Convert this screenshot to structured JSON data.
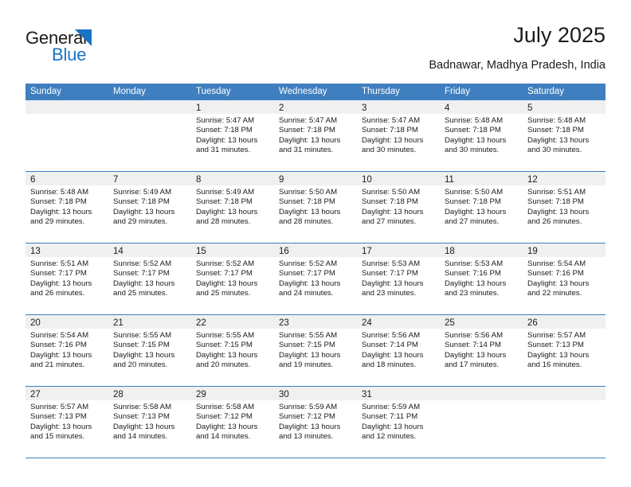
{
  "brand": {
    "name_part1": "General",
    "name_part2": "Blue",
    "accent_color": "#1b73c4"
  },
  "header": {
    "title": "July 2025",
    "location": "Badnawar, Madhya Pradesh, India"
  },
  "calendar": {
    "header_bg_color": "#3f7fbf",
    "day_band_color": "#f0f0f0",
    "weekday_headers": [
      "Sunday",
      "Monday",
      "Tuesday",
      "Wednesday",
      "Thursday",
      "Friday",
      "Saturday"
    ],
    "weeks": [
      [
        {
          "day": "",
          "lines": []
        },
        {
          "day": "",
          "lines": []
        },
        {
          "day": "1",
          "lines": [
            "Sunrise: 5:47 AM",
            "Sunset: 7:18 PM",
            "Daylight: 13 hours",
            "and 31 minutes."
          ]
        },
        {
          "day": "2",
          "lines": [
            "Sunrise: 5:47 AM",
            "Sunset: 7:18 PM",
            "Daylight: 13 hours",
            "and 31 minutes."
          ]
        },
        {
          "day": "3",
          "lines": [
            "Sunrise: 5:47 AM",
            "Sunset: 7:18 PM",
            "Daylight: 13 hours",
            "and 30 minutes."
          ]
        },
        {
          "day": "4",
          "lines": [
            "Sunrise: 5:48 AM",
            "Sunset: 7:18 PM",
            "Daylight: 13 hours",
            "and 30 minutes."
          ]
        },
        {
          "day": "5",
          "lines": [
            "Sunrise: 5:48 AM",
            "Sunset: 7:18 PM",
            "Daylight: 13 hours",
            "and 30 minutes."
          ]
        }
      ],
      [
        {
          "day": "6",
          "lines": [
            "Sunrise: 5:48 AM",
            "Sunset: 7:18 PM",
            "Daylight: 13 hours",
            "and 29 minutes."
          ]
        },
        {
          "day": "7",
          "lines": [
            "Sunrise: 5:49 AM",
            "Sunset: 7:18 PM",
            "Daylight: 13 hours",
            "and 29 minutes."
          ]
        },
        {
          "day": "8",
          "lines": [
            "Sunrise: 5:49 AM",
            "Sunset: 7:18 PM",
            "Daylight: 13 hours",
            "and 28 minutes."
          ]
        },
        {
          "day": "9",
          "lines": [
            "Sunrise: 5:50 AM",
            "Sunset: 7:18 PM",
            "Daylight: 13 hours",
            "and 28 minutes."
          ]
        },
        {
          "day": "10",
          "lines": [
            "Sunrise: 5:50 AM",
            "Sunset: 7:18 PM",
            "Daylight: 13 hours",
            "and 27 minutes."
          ]
        },
        {
          "day": "11",
          "lines": [
            "Sunrise: 5:50 AM",
            "Sunset: 7:18 PM",
            "Daylight: 13 hours",
            "and 27 minutes."
          ]
        },
        {
          "day": "12",
          "lines": [
            "Sunrise: 5:51 AM",
            "Sunset: 7:18 PM",
            "Daylight: 13 hours",
            "and 26 minutes."
          ]
        }
      ],
      [
        {
          "day": "13",
          "lines": [
            "Sunrise: 5:51 AM",
            "Sunset: 7:17 PM",
            "Daylight: 13 hours",
            "and 26 minutes."
          ]
        },
        {
          "day": "14",
          "lines": [
            "Sunrise: 5:52 AM",
            "Sunset: 7:17 PM",
            "Daylight: 13 hours",
            "and 25 minutes."
          ]
        },
        {
          "day": "15",
          "lines": [
            "Sunrise: 5:52 AM",
            "Sunset: 7:17 PM",
            "Daylight: 13 hours",
            "and 25 minutes."
          ]
        },
        {
          "day": "16",
          "lines": [
            "Sunrise: 5:52 AM",
            "Sunset: 7:17 PM",
            "Daylight: 13 hours",
            "and 24 minutes."
          ]
        },
        {
          "day": "17",
          "lines": [
            "Sunrise: 5:53 AM",
            "Sunset: 7:17 PM",
            "Daylight: 13 hours",
            "and 23 minutes."
          ]
        },
        {
          "day": "18",
          "lines": [
            "Sunrise: 5:53 AM",
            "Sunset: 7:16 PM",
            "Daylight: 13 hours",
            "and 23 minutes."
          ]
        },
        {
          "day": "19",
          "lines": [
            "Sunrise: 5:54 AM",
            "Sunset: 7:16 PM",
            "Daylight: 13 hours",
            "and 22 minutes."
          ]
        }
      ],
      [
        {
          "day": "20",
          "lines": [
            "Sunrise: 5:54 AM",
            "Sunset: 7:16 PM",
            "Daylight: 13 hours",
            "and 21 minutes."
          ]
        },
        {
          "day": "21",
          "lines": [
            "Sunrise: 5:55 AM",
            "Sunset: 7:15 PM",
            "Daylight: 13 hours",
            "and 20 minutes."
          ]
        },
        {
          "day": "22",
          "lines": [
            "Sunrise: 5:55 AM",
            "Sunset: 7:15 PM",
            "Daylight: 13 hours",
            "and 20 minutes."
          ]
        },
        {
          "day": "23",
          "lines": [
            "Sunrise: 5:55 AM",
            "Sunset: 7:15 PM",
            "Daylight: 13 hours",
            "and 19 minutes."
          ]
        },
        {
          "day": "24",
          "lines": [
            "Sunrise: 5:56 AM",
            "Sunset: 7:14 PM",
            "Daylight: 13 hours",
            "and 18 minutes."
          ]
        },
        {
          "day": "25",
          "lines": [
            "Sunrise: 5:56 AM",
            "Sunset: 7:14 PM",
            "Daylight: 13 hours",
            "and 17 minutes."
          ]
        },
        {
          "day": "26",
          "lines": [
            "Sunrise: 5:57 AM",
            "Sunset: 7:13 PM",
            "Daylight: 13 hours",
            "and 16 minutes."
          ]
        }
      ],
      [
        {
          "day": "27",
          "lines": [
            "Sunrise: 5:57 AM",
            "Sunset: 7:13 PM",
            "Daylight: 13 hours",
            "and 15 minutes."
          ]
        },
        {
          "day": "28",
          "lines": [
            "Sunrise: 5:58 AM",
            "Sunset: 7:13 PM",
            "Daylight: 13 hours",
            "and 14 minutes."
          ]
        },
        {
          "day": "29",
          "lines": [
            "Sunrise: 5:58 AM",
            "Sunset: 7:12 PM",
            "Daylight: 13 hours",
            "and 14 minutes."
          ]
        },
        {
          "day": "30",
          "lines": [
            "Sunrise: 5:59 AM",
            "Sunset: 7:12 PM",
            "Daylight: 13 hours",
            "and 13 minutes."
          ]
        },
        {
          "day": "31",
          "lines": [
            "Sunrise: 5:59 AM",
            "Sunset: 7:11 PM",
            "Daylight: 13 hours",
            "and 12 minutes."
          ]
        },
        {
          "day": "",
          "lines": []
        },
        {
          "day": "",
          "lines": []
        }
      ]
    ]
  }
}
